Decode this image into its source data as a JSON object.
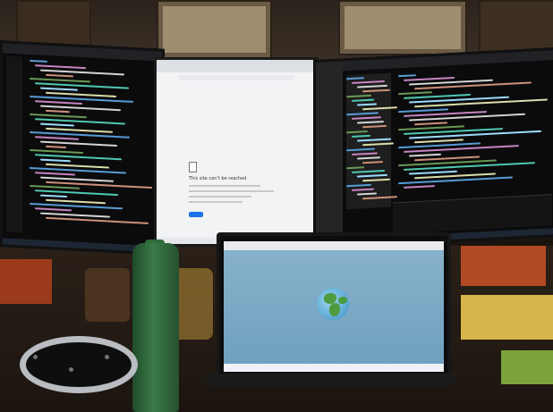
{
  "scene": {
    "colors": {
      "wall": "#2b231c",
      "desk": "#1c150f",
      "globe_ocean": "#56a5d2",
      "globe_land": "#4e9a3e",
      "browser_bg": "#f2f3f5",
      "bottle": "#3b7a48",
      "sticky_orange": "#b14a24",
      "sticky_yellow": "#d6b54a",
      "sticky_green": "#7aa43b"
    },
    "center_monitor": {
      "error_title": "This site can't be reached"
    },
    "icons": [
      "document-error-icon",
      "globe-icon"
    ]
  }
}
